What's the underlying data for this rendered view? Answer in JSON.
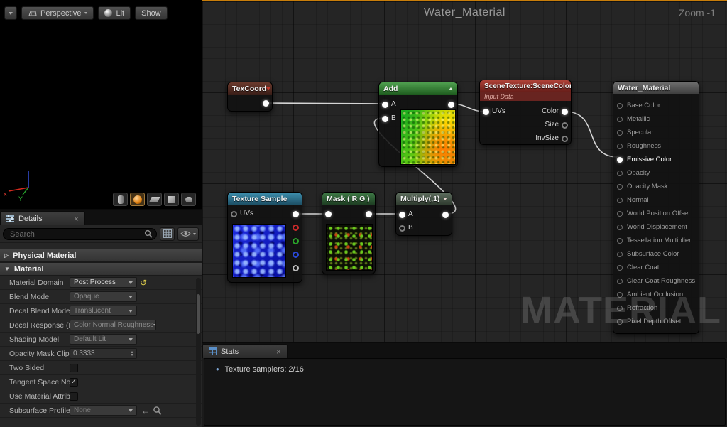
{
  "icons": {
    "close": "×",
    "bullet": "•",
    "reset": "↺",
    "back_arrow": "←"
  },
  "viewport": {
    "toolbar": {
      "perspective": "Perspective",
      "lit": "Lit",
      "show": "Show"
    },
    "axis": {
      "x_label": "x",
      "y_label": "Y"
    }
  },
  "details": {
    "tab": "Details",
    "search_placeholder": "Search",
    "sections": [
      {
        "arrow": "▷",
        "label": "Physical Material"
      },
      {
        "arrow": "▼",
        "label": "Material"
      }
    ],
    "rows": [
      {
        "label": "Material Domain",
        "value": "Post Process"
      },
      {
        "label": "Blend Mode",
        "value": "Opaque"
      },
      {
        "label": "Decal Blend Mode",
        "value": "Translucent"
      },
      {
        "label": "Decal Response (D",
        "value": "Color Normal Roughness"
      },
      {
        "label": "Shading Model",
        "value": "Default Lit"
      },
      {
        "label": "Opacity Mask Clip",
        "value": "0.3333"
      },
      {
        "label": "Two Sided",
        "check": ""
      },
      {
        "label": "Tangent Space No",
        "check": "✓"
      },
      {
        "label": "Use Material Attrib",
        "check": ""
      },
      {
        "label": "Subsurface Profile",
        "value": "None"
      }
    ]
  },
  "graph": {
    "title": "Water_Material",
    "zoom": "Zoom -1",
    "watermark": "MATERIAL",
    "nodes": {
      "texcoord": {
        "title": "TexCoord"
      },
      "add": {
        "title": "Add",
        "a": "A",
        "b": "B"
      },
      "scene_texture": {
        "title": "SceneTexture:SceneColor",
        "subtitle": "Input Data",
        "uvs": "UVs",
        "out_color": "Color",
        "out_size": "Size",
        "out_invsize": "InvSize"
      },
      "texture_sample": {
        "title": "Texture Sample",
        "uvs": "UVs"
      },
      "mask": {
        "title": "Mask ( R G )"
      },
      "multiply": {
        "title": "Multiply(,1)",
        "a": "A",
        "b": "B"
      },
      "material": {
        "title": "Water_Material",
        "pins": [
          "Base Color",
          "Metallic",
          "Specular",
          "Roughness",
          "Emissive Color",
          "Opacity",
          "Opacity Mask",
          "Normal",
          "World Position Offset",
          "World Displacement",
          "Tessellation Multiplier",
          "Subsurface Color",
          "Clear Coat",
          "Clear Coat Roughness",
          "Ambient Occlusion",
          "Refraction",
          "Pixel Depth Offset"
        ]
      }
    }
  },
  "stats": {
    "tab": "Stats",
    "items": [
      "Texture samplers: 2/16"
    ]
  }
}
